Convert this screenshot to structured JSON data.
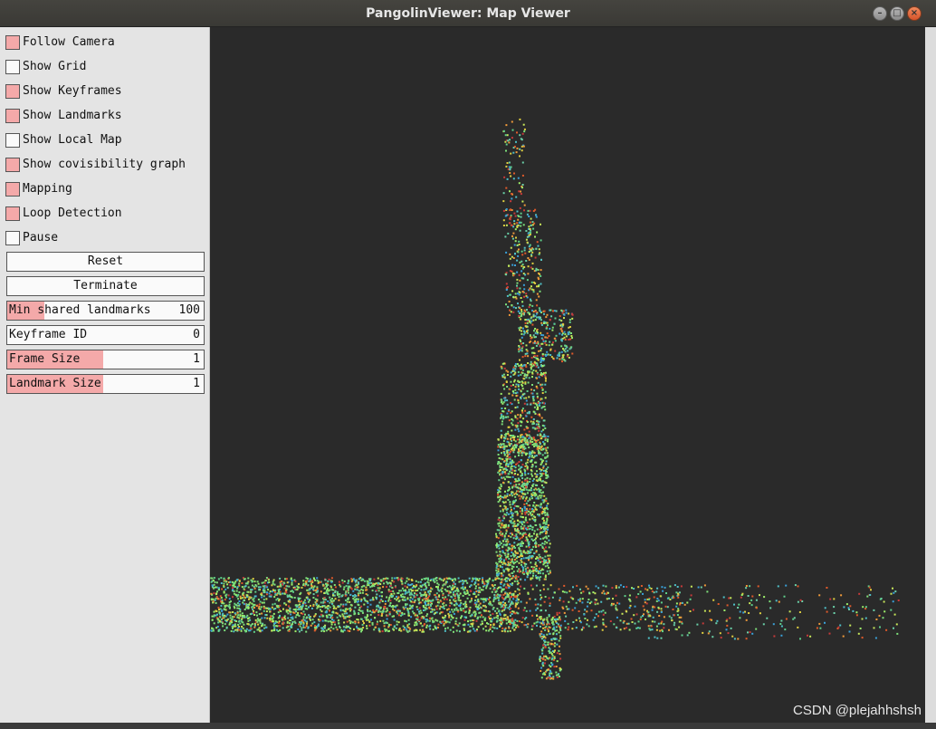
{
  "window": {
    "title": "PangolinViewer: Map Viewer"
  },
  "panel": {
    "checkboxes": [
      {
        "label": "Follow Camera",
        "checked": true
      },
      {
        "label": "Show Grid",
        "checked": false
      },
      {
        "label": "Show Keyframes",
        "checked": true
      },
      {
        "label": "Show Landmarks",
        "checked": true
      },
      {
        "label": "Show Local Map",
        "checked": false
      },
      {
        "label": "Show covisibility graph",
        "checked": true
      },
      {
        "label": "Mapping",
        "checked": true
      },
      {
        "label": "Loop Detection",
        "checked": true
      },
      {
        "label": "Pause",
        "checked": false
      }
    ],
    "buttons": {
      "reset": "Reset",
      "terminate": "Terminate"
    },
    "variables": {
      "min_shared": {
        "label": "Min shared landmarks",
        "value": "100",
        "fraction": 0.19
      },
      "keyframe_id": {
        "label": "Keyframe ID",
        "value": "0",
        "fraction": 0
      },
      "frame_size": {
        "label": "Frame Size",
        "value": "1",
        "fraction": 0.49
      },
      "landmark_size": {
        "label": "Landmark Size",
        "value": "1",
        "fraction": 0.49
      }
    }
  },
  "colors": {
    "checked": "#f4a9a9",
    "background": "#2a2a2a"
  },
  "watermark": "CSDN @plejahhshsh"
}
